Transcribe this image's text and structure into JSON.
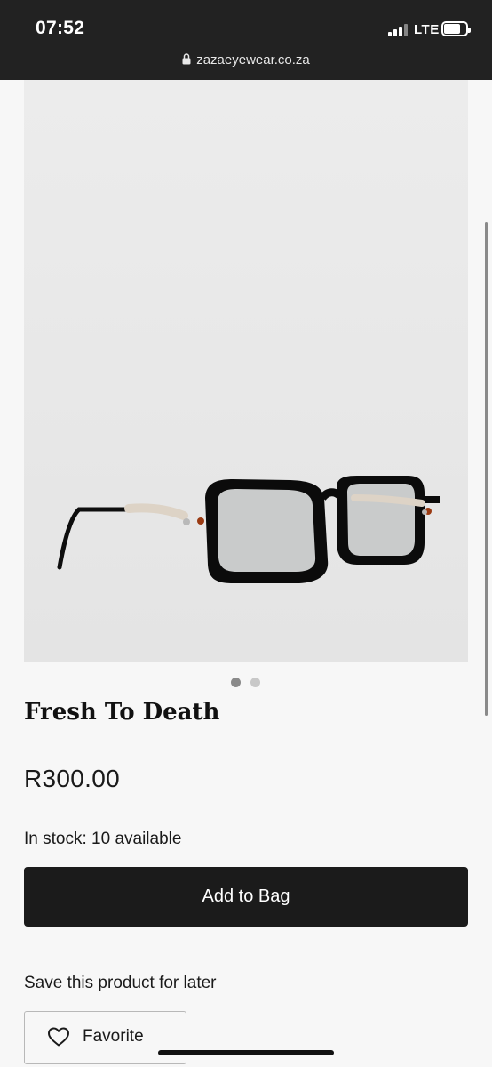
{
  "status_bar": {
    "time": "07:52",
    "network": "LTE",
    "url": "zazaeyewear.co.za"
  },
  "product": {
    "image_description_icon": "eyeglasses-image",
    "title": "Fresh To Death",
    "price": "R300.00",
    "stock": "In stock: 10 available",
    "carousel": {
      "total": 2,
      "active": 1
    }
  },
  "actions": {
    "add_to_bag": "Add to Bag",
    "save_prompt": "Save this product for later",
    "favorite": "Favorite"
  },
  "colors": {
    "status_bar_bg": "#222222",
    "button_bg": "#1b1b1b",
    "page_bg": "#f7f7f7"
  }
}
